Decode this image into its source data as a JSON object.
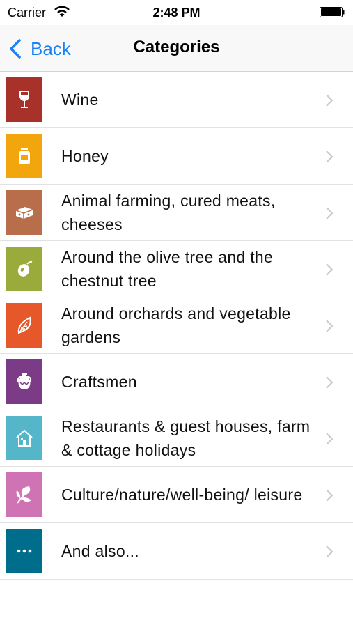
{
  "status_bar": {
    "carrier": "Carrier",
    "time": "2:48 PM"
  },
  "nav": {
    "back_label": "Back",
    "title": "Categories"
  },
  "categories": [
    {
      "label": "Wine",
      "color": "#a8322a",
      "icon": "wine-glass-icon"
    },
    {
      "label": "Honey",
      "color": "#f2a50c",
      "icon": "honey-jar-icon"
    },
    {
      "label": "Animal farming, cured meats, cheeses",
      "color": "#b96e4b",
      "icon": "cheese-icon"
    },
    {
      "label": "Around the olive tree and the chestnut tree",
      "color": "#9aab3c",
      "icon": "olive-icon"
    },
    {
      "label": "Around orchards and vegetable gardens",
      "color": "#e6582a",
      "icon": "leaf-icon"
    },
    {
      "label": "Craftsmen",
      "color": "#7c3b86",
      "icon": "amphora-icon"
    },
    {
      "label": "Restaurants & guest houses, farm & cottage holidays",
      "color": "#55b5c9",
      "icon": "house-icon"
    },
    {
      "label": "Culture/nature/well-being/ leisure",
      "color": "#cf73b5",
      "icon": "plant-icon"
    },
    {
      "label": "And also...",
      "color": "#006d8c",
      "icon": "more-dots-icon"
    }
  ]
}
